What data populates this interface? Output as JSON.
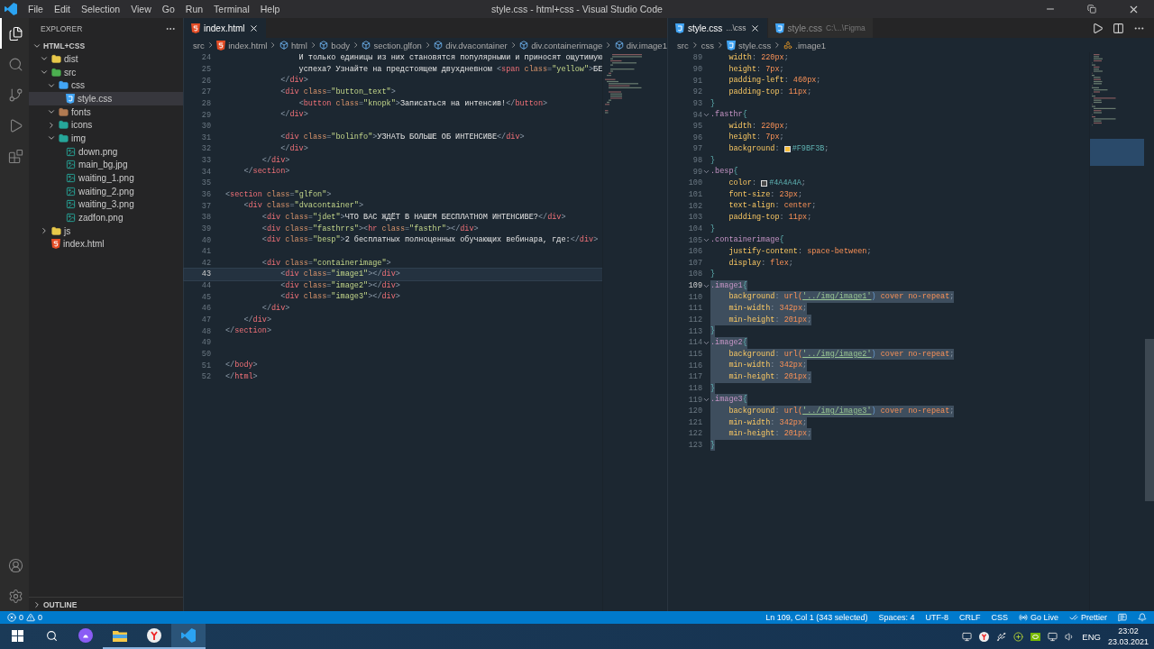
{
  "title_bar": {
    "menu": [
      "File",
      "Edit",
      "Selection",
      "View",
      "Go",
      "Run",
      "Terminal",
      "Help"
    ],
    "title": "style.css - html+css - Visual Studio Code"
  },
  "activity_bar": [
    {
      "kind": "explorer",
      "selected": true
    },
    {
      "kind": "search",
      "selected": false
    },
    {
      "kind": "scm",
      "selected": false
    },
    {
      "kind": "run",
      "selected": false
    },
    {
      "kind": "extensions",
      "selected": false
    }
  ],
  "activity_bottom": [
    {
      "kind": "account"
    },
    {
      "kind": "settings"
    }
  ],
  "sidebar": {
    "title": "EXPLORER",
    "root": {
      "label": "HTML+CSS",
      "expanded": true
    },
    "tree": [
      {
        "label": "dist",
        "kind": "folder",
        "color": "#e8c84a",
        "expanded": true,
        "selected": false
      },
      {
        "label": "src",
        "kind": "folder",
        "color": "#4caf50",
        "expanded": true,
        "selected": false,
        "children": [
          {
            "label": "css",
            "kind": "folder",
            "color": "#42a5f5",
            "expanded": true,
            "selected": false,
            "children": [
              {
                "label": "style.css",
                "kind": "css",
                "selected": true
              }
            ]
          },
          {
            "label": "fonts",
            "kind": "folder",
            "color": "#b07a52",
            "expanded": true,
            "selected": false
          },
          {
            "label": "icons",
            "kind": "folder",
            "color": "#26a69a",
            "expanded": false,
            "selected": false
          },
          {
            "label": "img",
            "kind": "folder",
            "color": "#26a69a",
            "expanded": true,
            "selected": false,
            "children": [
              {
                "label": "down.png",
                "kind": "image",
                "selected": false
              },
              {
                "label": "main_bg.jpg",
                "kind": "image",
                "selected": false
              },
              {
                "label": "waiting_1.png",
                "kind": "image",
                "selected": false
              },
              {
                "label": "waiting_2.png",
                "kind": "image",
                "selected": false
              },
              {
                "label": "waiting_3.png",
                "kind": "image",
                "selected": false
              },
              {
                "label": "zadfon.png",
                "kind": "image",
                "selected": false
              }
            ]
          }
        ]
      },
      {
        "label": "js",
        "kind": "folder",
        "color": "#e8c84a",
        "expanded": false,
        "selected": false
      },
      {
        "label": "index.html",
        "kind": "html",
        "selected": false
      }
    ],
    "outline": {
      "label": "OUTLINE",
      "expanded": false
    }
  },
  "editors": [
    {
      "tabs": [
        {
          "label": "index.html",
          "kind": "html",
          "selected": true
        }
      ],
      "breadcrumbs": [
        {
          "label": "src",
          "kind": "plain"
        },
        {
          "label": "index.html",
          "kind": "html"
        },
        {
          "label": "html",
          "kind": "element"
        },
        {
          "label": "body",
          "kind": "element"
        },
        {
          "label": "section.glfon",
          "kind": "element"
        },
        {
          "label": "div.dvacontainer",
          "kind": "element"
        },
        {
          "label": "div.containerimage",
          "kind": "element"
        },
        {
          "label": "div.image1",
          "kind": "element"
        }
      ],
      "lines": [
        {
          "n": "24",
          "code": "                И только единицы из них становятся популярными и приносят ощутимую"
        },
        {
          "n": "25",
          "code": "                успеха? Узнайте на предстоящем двухдневном <span class=\"yellow\">БЕ"
        },
        {
          "n": "26",
          "code": "            </div>"
        },
        {
          "n": "27",
          "code": "            <div class=\"button_text\">"
        },
        {
          "n": "28",
          "code": "                <button class=\"knopk\">Записаться на интенсив!</button>"
        },
        {
          "n": "29",
          "code": "            </div>"
        },
        {
          "n": "30"
        },
        {
          "n": "31",
          "code": "            <div class=\"bolinfo\">УЗНАТЬ БОЛЬШЕ ОБ ИНТЕНСИВЕ</div>"
        },
        {
          "n": "32",
          "code": "            </div>"
        },
        {
          "n": "33",
          "code": "        </div>"
        },
        {
          "n": "34",
          "code": "    </section>"
        },
        {
          "n": "35"
        },
        {
          "n": "36",
          "code": "<section class=\"glfon\">"
        },
        {
          "n": "37",
          "code": "    <div class=\"dvacontainer\">"
        },
        {
          "n": "38",
          "code": "        <div class=\"jdet\">ЧТО ВАС ЖДЁТ В НАШЕМ БЕСПЛАТНОМ ИНТЕНСИВЕ?</div>"
        },
        {
          "n": "39",
          "code": "        <div class=\"fasthrrs\"><hr class=\"fasthr\"></div>"
        },
        {
          "n": "40",
          "code": "        <div class=\"besp\">2 бесплатных полноценных обучающих вебинара, где:</div>"
        },
        {
          "n": "41"
        },
        {
          "n": "42",
          "code": "        <div class=\"containerimage\">"
        },
        {
          "n": "43",
          "code": "            <div class=\"image1\"></div>",
          "current": true
        },
        {
          "n": "44",
          "code": "            <div class=\"image2\"></div>"
        },
        {
          "n": "45",
          "code": "            <div class=\"image3\"></div>"
        },
        {
          "n": "46",
          "code": "        </div>"
        },
        {
          "n": "47",
          "code": "    </div>"
        },
        {
          "n": "48",
          "code": "</section>"
        },
        {
          "n": "49"
        },
        {
          "n": "50"
        },
        {
          "n": "51",
          "code": "</body>"
        },
        {
          "n": "52",
          "code": "</html>"
        }
      ]
    },
    {
      "tabs": [
        {
          "label": "style.css",
          "description": "...\\css",
          "kind": "css",
          "selected": true
        },
        {
          "label": "style.css",
          "description": "C:\\...\\Figma",
          "kind": "css",
          "selected": false
        }
      ],
      "breadcrumbs": [
        {
          "label": "src",
          "kind": "plain"
        },
        {
          "label": "css",
          "kind": "plain"
        },
        {
          "label": "style.css",
          "kind": "css"
        },
        {
          "label": ".image1",
          "kind": "selector"
        }
      ],
      "lines": [
        {
          "n": "89",
          "code": "    width: 220px;"
        },
        {
          "n": "90",
          "code": "    height: 7px;"
        },
        {
          "n": "91",
          "code": "    padding-left: 460px;"
        },
        {
          "n": "92",
          "code": "    padding-top: 11px;"
        },
        {
          "n": "93",
          "code": "}"
        },
        {
          "n": "94",
          "code": ".fasthr{",
          "fold": true
        },
        {
          "n": "95",
          "code": "    width: 220px;"
        },
        {
          "n": "96",
          "code": "    height: 7px;"
        },
        {
          "n": "97",
          "code": "    background: #F9BF3B;"
        },
        {
          "n": "98",
          "code": "}"
        },
        {
          "n": "99",
          "code": ".besp{",
          "fold": true
        },
        {
          "n": "100",
          "code": "    color: #4A4A4A;"
        },
        {
          "n": "101",
          "code": "    font-size: 23px;"
        },
        {
          "n": "102",
          "code": "    text-align: center;"
        },
        {
          "n": "103",
          "code": "    padding-top: 11px;"
        },
        {
          "n": "104",
          "code": "}"
        },
        {
          "n": "105",
          "code": ".containerimage{",
          "fold": true
        },
        {
          "n": "106",
          "code": "    justify-content: space-between;"
        },
        {
          "n": "107",
          "code": "    display: flex;"
        },
        {
          "n": "108",
          "code": "}"
        },
        {
          "n": "109",
          "code": ".image1{",
          "fold": true,
          "selected": true,
          "current": true
        },
        {
          "n": "110",
          "code": "    background: url('../img/image1') cover no-repeat;",
          "selected": true
        },
        {
          "n": "111",
          "code": "    min-width: 342px;",
          "selected": true
        },
        {
          "n": "112",
          "code": "    min-height: 201px;",
          "selected": true
        },
        {
          "n": "113",
          "code": "}",
          "selected": true
        },
        {
          "n": "114",
          "code": ".image2{",
          "fold": true,
          "selected": true
        },
        {
          "n": "115",
          "code": "    background: url('../img/image2') cover no-repeat;",
          "selected": true
        },
        {
          "n": "116",
          "code": "    min-width: 342px;",
          "selected": true
        },
        {
          "n": "117",
          "code": "    min-height: 201px;",
          "selected": true
        },
        {
          "n": "118",
          "code": "}",
          "selected": true
        },
        {
          "n": "119",
          "code": ".image3{",
          "fold": true,
          "selected": true
        },
        {
          "n": "120",
          "code": "    background: url('../img/image3') cover no-repeat;",
          "selected": true
        },
        {
          "n": "121",
          "code": "    min-width: 342px;",
          "selected": true
        },
        {
          "n": "122",
          "code": "    min-height: 201px;",
          "selected": true
        },
        {
          "n": "123",
          "code": "}",
          "selected": true
        }
      ]
    }
  ],
  "status_bar": {
    "errors": "0",
    "warnings": "0",
    "items": [
      {
        "label": "Ln 109, Col 1 (343 selected)",
        "kind": "text"
      },
      {
        "label": "Spaces: 4",
        "kind": "text"
      },
      {
        "label": "UTF-8",
        "kind": "text"
      },
      {
        "label": "CRLF",
        "kind": "text"
      },
      {
        "label": "CSS",
        "kind": "text"
      },
      {
        "label": "Go Live",
        "kind": "golive"
      },
      {
        "label": "Prettier",
        "kind": "prettier"
      },
      {
        "kind": "feedback"
      },
      {
        "kind": "bell"
      }
    ]
  },
  "taskbar": {
    "apps": [
      {
        "kind": "start",
        "running": false,
        "selected": false
      },
      {
        "kind": "search",
        "running": false,
        "selected": false
      },
      {
        "kind": "assistant",
        "running": false,
        "selected": false
      },
      {
        "kind": "files",
        "running": true,
        "selected": false
      },
      {
        "kind": "browser",
        "running": true,
        "selected": false
      },
      {
        "kind": "vscode",
        "running": true,
        "selected": true
      }
    ],
    "tray_icons": [
      {
        "kind": "game"
      },
      {
        "kind": "browser"
      },
      {
        "kind": "usb"
      },
      {
        "kind": "plus"
      },
      {
        "kind": "gpu"
      },
      {
        "kind": "network"
      },
      {
        "kind": "volume"
      }
    ],
    "language": "ENG",
    "time": "23:02",
    "date": "23.03.2021"
  }
}
